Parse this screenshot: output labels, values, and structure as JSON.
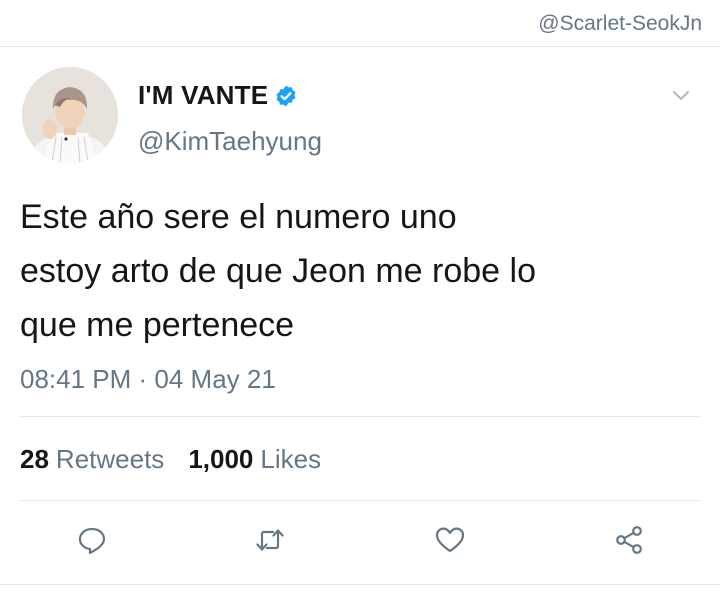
{
  "watermark": "@Scarlet-SeokJn",
  "user": {
    "display_name": "I'M VANTE",
    "handle": "@KimTaehyung",
    "verified": true
  },
  "tweet": {
    "lines": [
      "Este año sere el numero uno",
      "estoy arto de que Jeon me robe lo",
      "que me pertenece"
    ],
    "timestamp": "08:41 PM · 04 May 21"
  },
  "stats": {
    "retweets_count": "28",
    "retweets_label": "Retweets",
    "likes_count": "1,000",
    "likes_label": "Likes"
  },
  "icons": {
    "caret": "chevron-down-icon",
    "reply": "reply-icon",
    "retweet": "retweet-icon",
    "like": "heart-icon",
    "share": "share-icon"
  },
  "colors": {
    "verified": "#1da1f2",
    "secondary_text": "#657786",
    "primary_text": "#14171a",
    "divider": "#e1e8ed"
  }
}
